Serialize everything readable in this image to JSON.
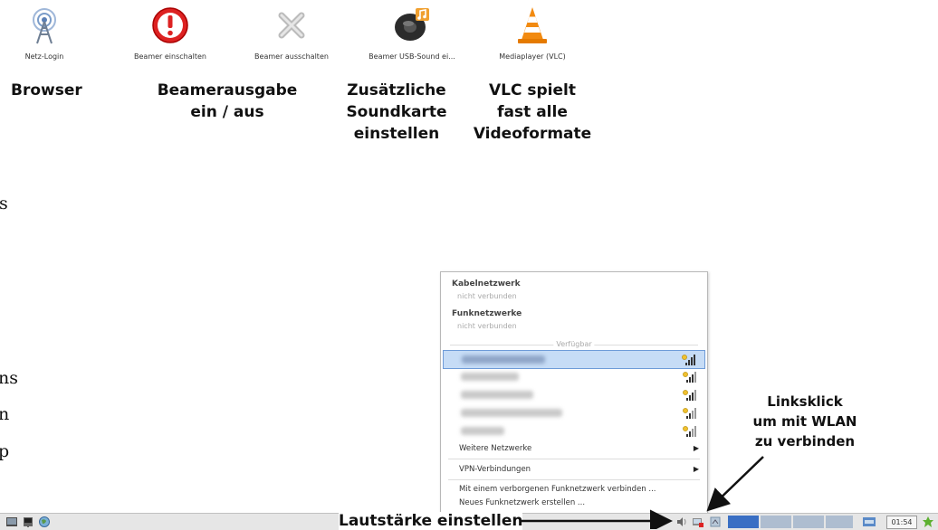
{
  "desktop_icons": [
    {
      "label": "Netz-Login",
      "icon": "network-tower-icon"
    },
    {
      "label": "Beamer einschalten",
      "icon": "red-exclamation-icon"
    },
    {
      "label": "Beamer ausschalten",
      "icon": "grey-x-icon"
    },
    {
      "label": "Beamer USB-Sound ei...",
      "icon": "music-speaker-icon"
    },
    {
      "label": "Mediaplayer (VLC)",
      "icon": "vlc-cone-icon"
    }
  ],
  "captions": {
    "browser": "Browser",
    "beamer_line1": "Beamerausgabe",
    "beamer_line2": "ein / aus",
    "sound_line1": "Zusätzliche",
    "sound_line2": "Soundkarte",
    "sound_line3": "einstellen",
    "vlc_line1": "VLC spielt",
    "vlc_line2": "fast alle",
    "vlc_line3": "Videoformate"
  },
  "left_edge_text": [
    "s",
    "ns",
    "n",
    "p"
  ],
  "network_menu": {
    "wired_header": "Kabelnetzwerk",
    "wired_status": "nicht verbunden",
    "wireless_header": "Funknetzwerke",
    "wireless_status": "nicht verbunden",
    "available_label": "Verfügbar",
    "networks": [
      {
        "name": "",
        "selected": true,
        "signal": 0.75
      },
      {
        "name": "",
        "selected": false,
        "signal": 0.75
      },
      {
        "name": "",
        "selected": false,
        "signal": 0.75
      },
      {
        "name": "",
        "selected": false,
        "signal": 0.75
      },
      {
        "name": "",
        "selected": false,
        "signal": 0.75
      }
    ],
    "more_networks": "Weitere Netzwerke",
    "vpn": "VPN-Verbindungen",
    "hidden_network": "Mit einem verborgenen Funknetzwerk verbinden ...",
    "new_network": "Neues Funknetzwerk erstellen ..."
  },
  "annotations": {
    "volume": "Lautstärke einstellen",
    "wlan_line1": "Linksklick",
    "wlan_line2": "um mit WLAN",
    "wlan_line3": "zu verbinden"
  },
  "taskbar": {
    "clock": "01:54",
    "accent_color": "#3a6fc4"
  }
}
